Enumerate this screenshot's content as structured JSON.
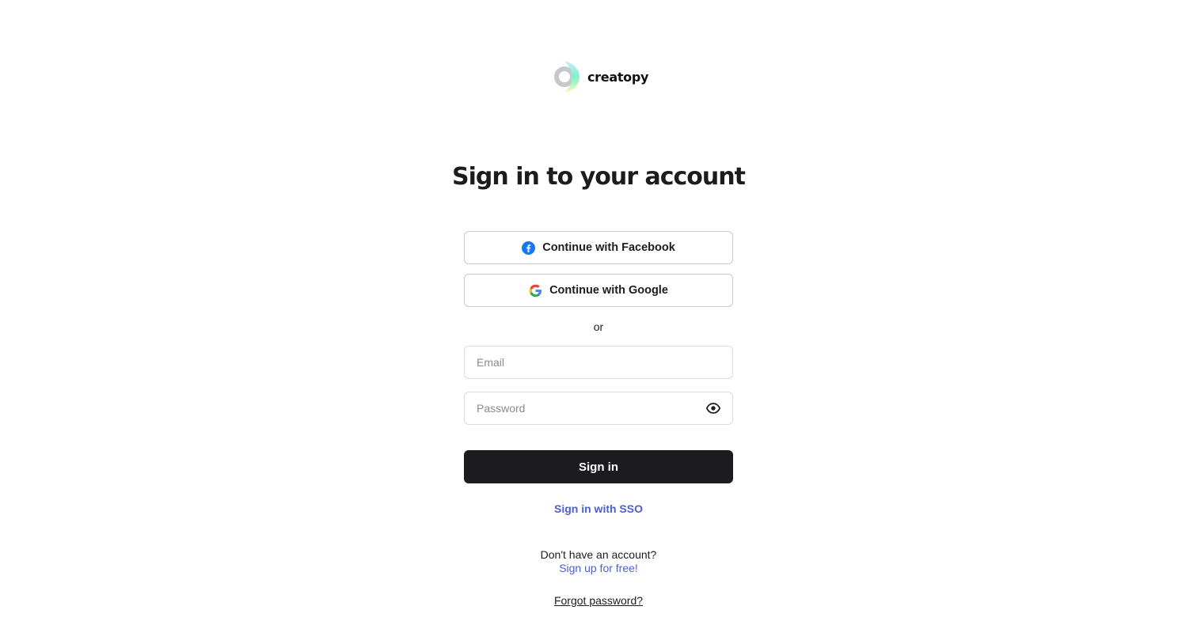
{
  "brand": {
    "name": "creatopy",
    "logo_icon": "creatopy-logo-icon"
  },
  "heading": "Sign in to your account",
  "social": {
    "facebook_label": "Continue with Facebook",
    "facebook_icon": "facebook-icon",
    "google_label": "Continue with Google",
    "google_icon": "google-icon"
  },
  "divider_text": "or",
  "form": {
    "email_placeholder": "Email",
    "email_value": "",
    "password_placeholder": "Password",
    "password_value": "",
    "password_toggle_icon": "eye-icon",
    "submit_label": "Sign in"
  },
  "links": {
    "sso": "Sign in with SSO",
    "no_account": "Don't have an account?",
    "signup": "Sign up for free!",
    "forgot": "Forgot password?"
  },
  "colors": {
    "primary_button": "#1c1c1e",
    "link": "#4a5fd6",
    "facebook": "#1877f2"
  }
}
